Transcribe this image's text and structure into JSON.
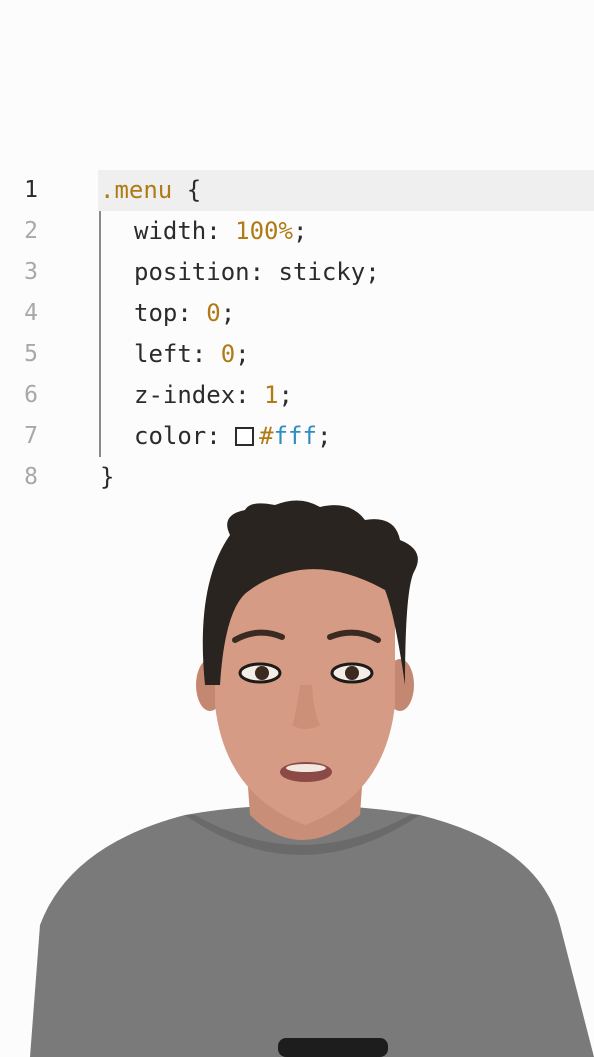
{
  "editor": {
    "lines": [
      {
        "number": "1",
        "selector": ".menu",
        "open_brace": " {"
      },
      {
        "number": "2",
        "prop": "width: ",
        "value": "100%",
        "end": ";"
      },
      {
        "number": "3",
        "prop": "position: sticky;"
      },
      {
        "number": "4",
        "prop": "top: ",
        "value": "0",
        "end": ";"
      },
      {
        "number": "5",
        "prop": "left: ",
        "value": "0",
        "end": ";"
      },
      {
        "number": "6",
        "prop": "z-index: ",
        "value": "1",
        "end": ";"
      },
      {
        "number": "7",
        "prop": "color: ",
        "hash": "#",
        "hex": "fff",
        "end": ";"
      },
      {
        "number": "8",
        "close_brace": "}"
      }
    ],
    "swatch_color": "#ffffff",
    "colors": {
      "keyword": "#b07a15",
      "hex_value": "#2e8ec2",
      "text": "#2b2b2b",
      "line_number": "#a8a8a8",
      "active_line_bg": "#efefef"
    }
  }
}
